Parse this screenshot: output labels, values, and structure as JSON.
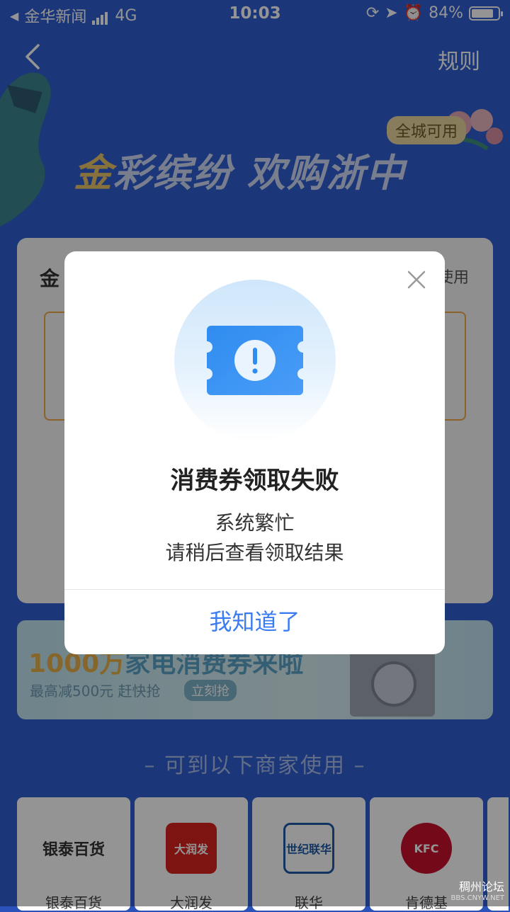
{
  "status_bar": {
    "carrier": "金华新闻",
    "network": "4G",
    "time": "10:03",
    "battery": "84%"
  },
  "header": {
    "rules_label": "规则"
  },
  "banner": {
    "title_gold": "金",
    "title_rest": "彩缤纷 欢购浙中",
    "tag": "全城可用"
  },
  "coupon_card": {
    "title_partial": "金",
    "side_partial": "使用"
  },
  "promo": {
    "title_big": "1000万",
    "title_rest": "家电消费券来啦",
    "subtitle": "最高减500元 赶快抢",
    "button": "立刻抢"
  },
  "merchants_section": {
    "title": "– 可到以下商家使用 –",
    "items": [
      {
        "name": "银泰百货",
        "logo_text": "银泰百货"
      },
      {
        "name": "大润发",
        "logo_text": "大润发"
      },
      {
        "name": "联华",
        "logo_text": "世纪联华"
      },
      {
        "name": "肯德基",
        "logo_text": "KFC"
      }
    ]
  },
  "dialog": {
    "title": "消费券领取失败",
    "line1": "系统繁忙",
    "line2": "请稍后查看领取结果",
    "ok_label": "我知道了"
  },
  "watermark": {
    "name": "稠州论坛",
    "url": "BBS.CNYW.NET"
  },
  "colors": {
    "page_bg": "#2f5ed0",
    "accent_blue": "#3b7df0",
    "gold": "#e8c46a"
  }
}
